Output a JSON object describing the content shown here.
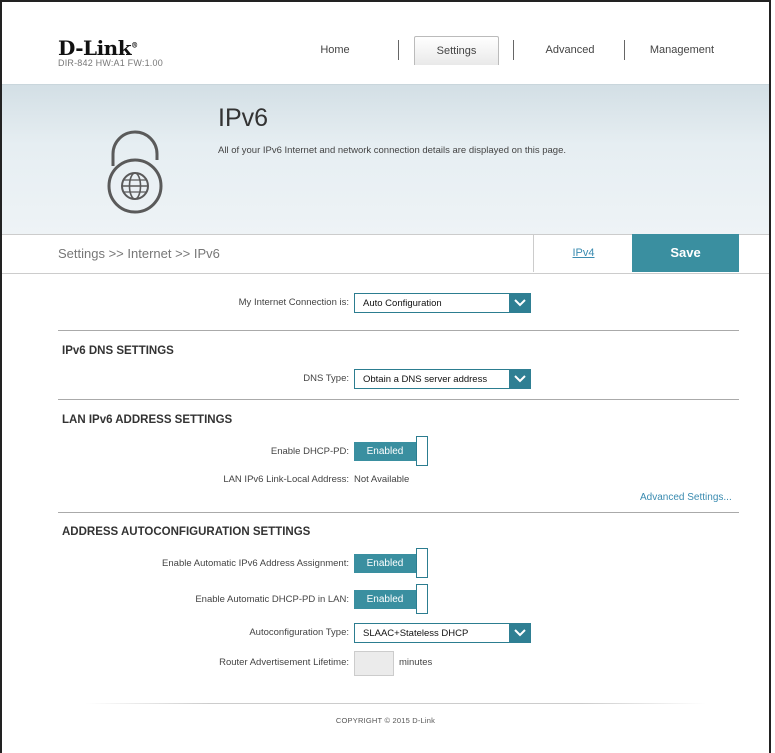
{
  "brand": {
    "logo": "D-Link",
    "model_info": "DIR-842   HW:A1   FW:1.00"
  },
  "nav": {
    "home": "Home",
    "settings": "Settings",
    "advanced": "Advanced",
    "management": "Management"
  },
  "banner": {
    "title": "IPv6",
    "description": "All of your IPv6 Internet and network connection details are displayed on this page.",
    "icon": "globe-lock-icon"
  },
  "breadcrumb": "Settings >> Internet >> IPv6",
  "tabs": {
    "ipv4": "IPv4",
    "save": "Save"
  },
  "connection": {
    "label": "My Internet Connection is:",
    "value": "Auto Configuration"
  },
  "dns_section": {
    "title": "IPv6 DNS SETTINGS",
    "dns_type_label": "DNS Type:",
    "dns_type_value": "Obtain a DNS server address"
  },
  "lan_section": {
    "title": "LAN IPv6 ADDRESS SETTINGS",
    "dhcp_pd_label": "Enable DHCP-PD:",
    "dhcp_pd_value": "Enabled",
    "link_local_label": "LAN IPv6 Link-Local Address:",
    "link_local_value": "Not Available",
    "advanced_link": "Advanced Settings..."
  },
  "autoconf_section": {
    "title": "ADDRESS AUTOCONFIGURATION SETTINGS",
    "auto_assign_label": "Enable Automatic IPv6 Address Assignment:",
    "auto_assign_value": "Enabled",
    "auto_dhcp_pd_label": "Enable Automatic DHCP-PD in LAN:",
    "auto_dhcp_pd_value": "Enabled",
    "type_label": "Autoconfiguration Type:",
    "type_value": "SLAAC+Stateless DHCP",
    "lifetime_label": "Router Advertisement Lifetime:",
    "lifetime_value": "",
    "lifetime_unit": "minutes"
  },
  "footer": "COPYRIGHT © 2015 D-Link",
  "colors": {
    "accent": "#3a8fa0",
    "link": "#3a8bb0"
  }
}
